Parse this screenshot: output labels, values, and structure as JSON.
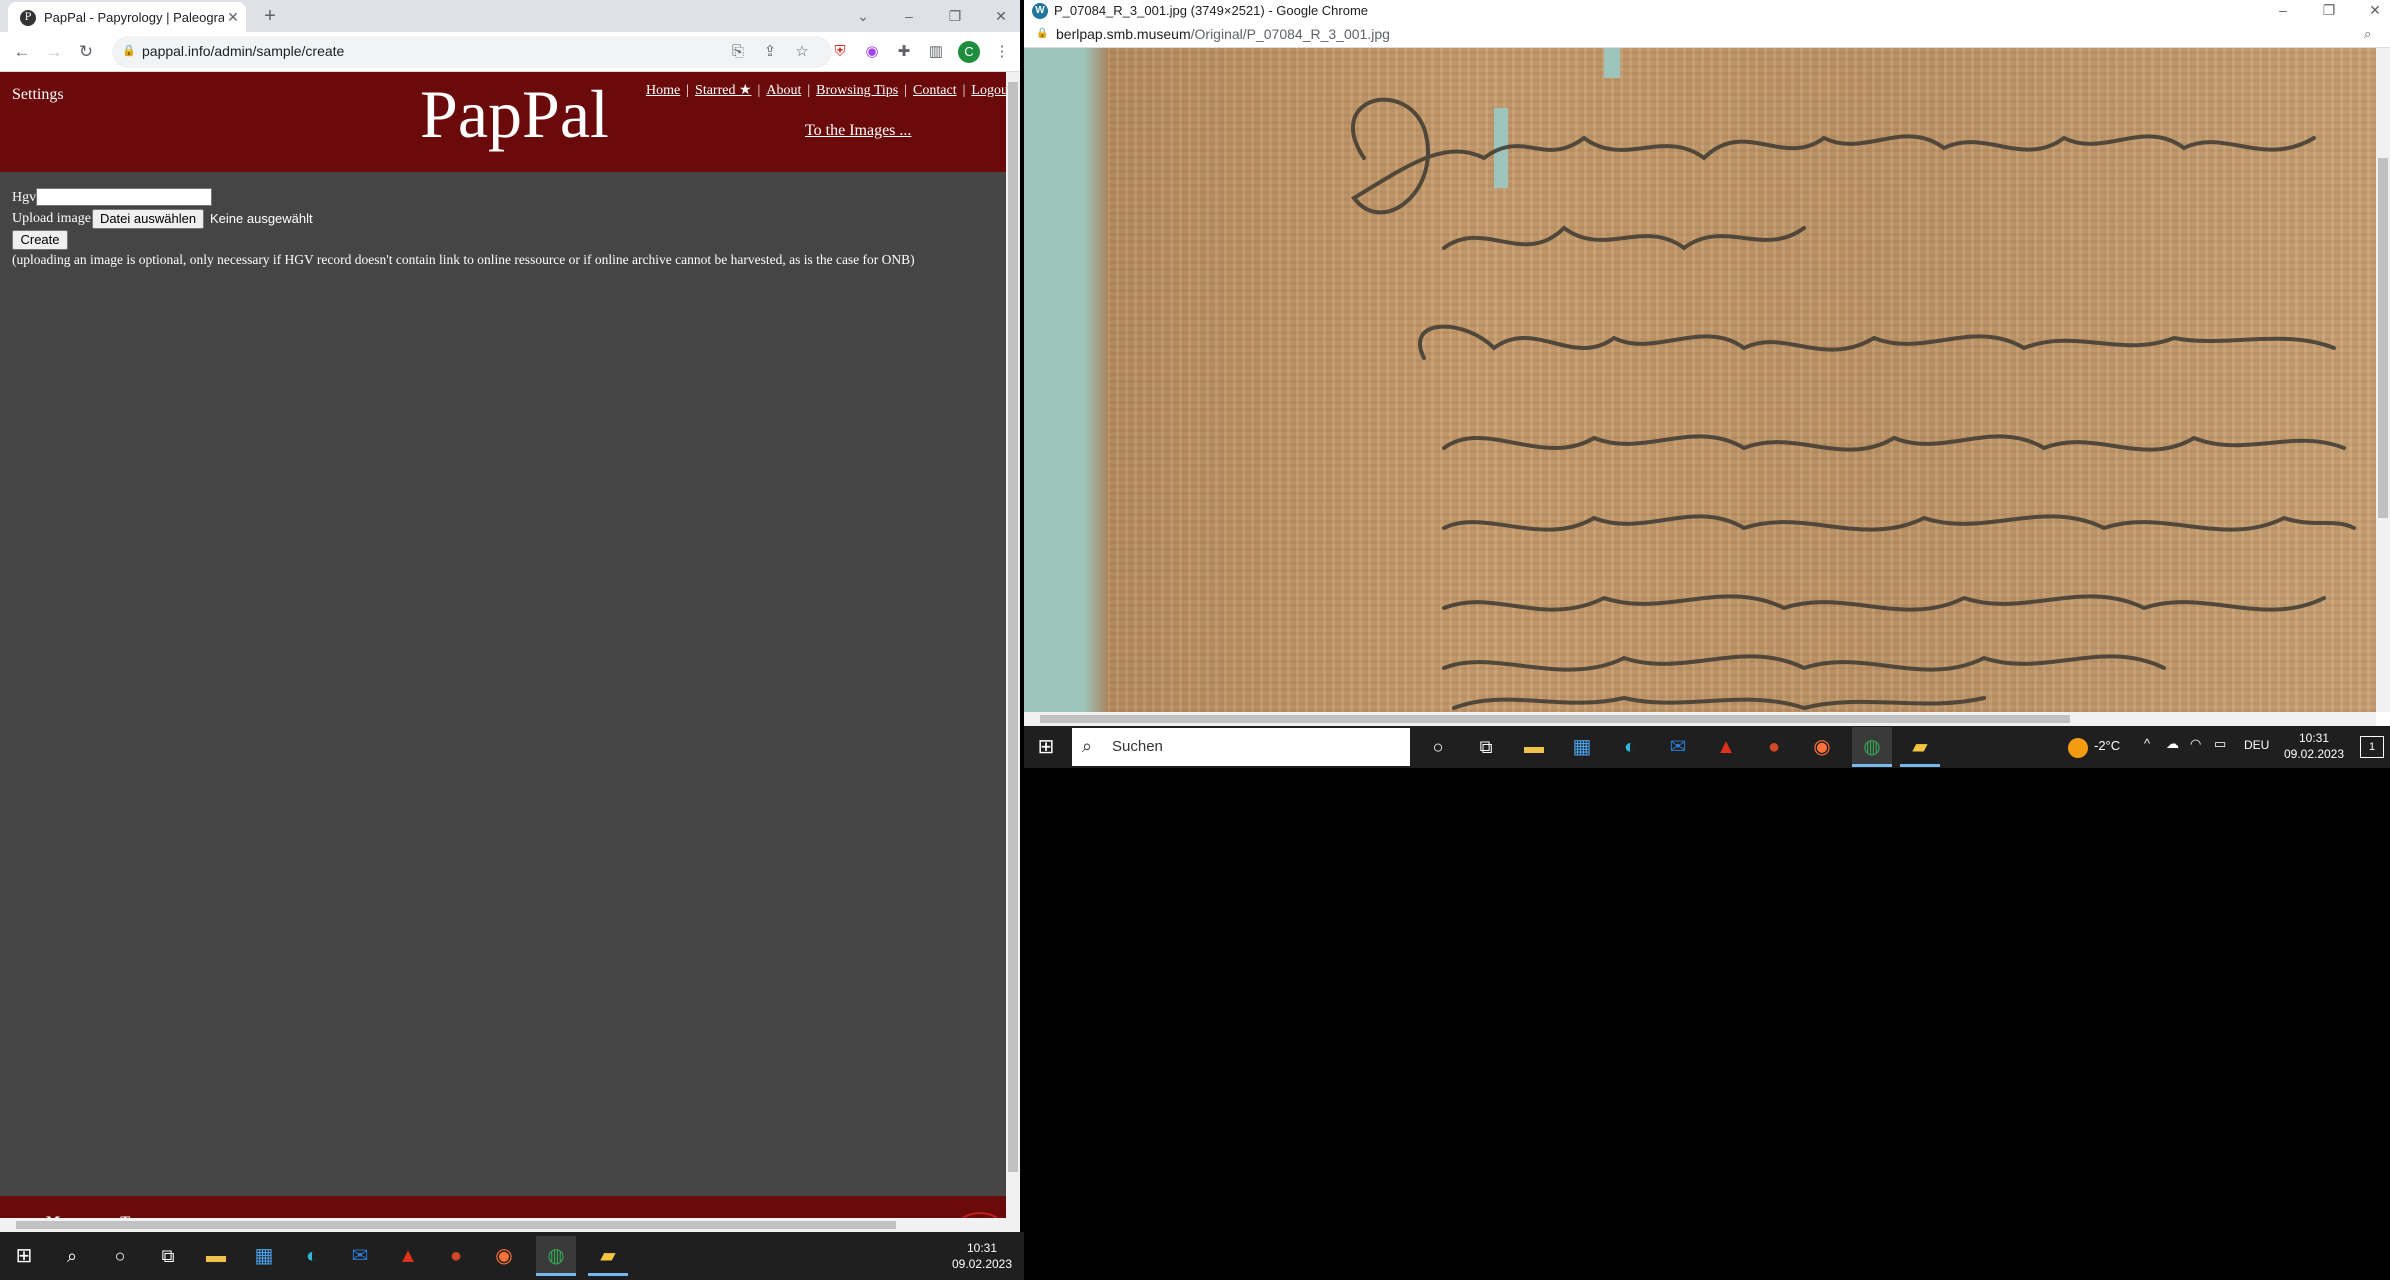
{
  "left_browser": {
    "tab_title": "PapPal - Papyrology | Paleograph",
    "url": "pappal.info/admin/sample/create",
    "profile_initial": "C"
  },
  "pappal": {
    "settings_label": "Settings",
    "logo": "PapPal",
    "nav": [
      "Home",
      "Starred ★",
      "About",
      "Browsing Tips",
      "Contact",
      "Logout"
    ],
    "to_images": "To the Images ...",
    "hgv_label": "Hgv",
    "hgv_value": "",
    "upload_label": "Upload image",
    "file_button": "Datei auswählen",
    "file_status": "Keine ausgewählt",
    "create_button": "Create",
    "note": "(uploading an image is optional, only necessary if HGV record doesn't contain link to online ressource or if online archive cannot be harvested, as is the case for ONB)",
    "footer": "Materiale Textkulturen"
  },
  "right_browser": {
    "window_title": "P_07084_R_3_001.jpg (3749×2521) - Google Chrome",
    "url_domain": "berlpap.smb.museum",
    "url_path": "/Original/P_07084_R_3_001.jpg"
  },
  "taskbar_right": {
    "search_placeholder": "Suchen",
    "weather": "-2°C",
    "language": "DEU",
    "time": "10:31",
    "date": "09.02.2023",
    "notification_count": "1"
  },
  "taskbar_left": {
    "time": "10:31",
    "date": "09.02.2023"
  },
  "colors": {
    "pappal_red": "#6b0a0a",
    "page_bg": "#454545",
    "taskbar": "#1f1f1f"
  }
}
